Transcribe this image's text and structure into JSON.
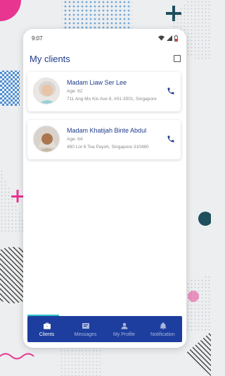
{
  "status_bar": {
    "time": "9:07"
  },
  "header": {
    "title": "My clients"
  },
  "clients": [
    {
      "name": "Madam Liaw Ser Lee",
      "age": "Age: 62",
      "address": "711 Ang Mo Kio Ave 8, #01-3501, Singapore"
    },
    {
      "name": "Madam Khatijah Binte Abdul",
      "age": "Age: 64",
      "address": "480 Lor 6 Toa Payoh, Singapore 310480"
    }
  ],
  "nav": {
    "items": [
      {
        "label": "Clients",
        "icon": "briefcase-icon"
      },
      {
        "label": "Messages",
        "icon": "message-icon"
      },
      {
        "label": "My Profile",
        "icon": "person-icon"
      },
      {
        "label": "Notification",
        "icon": "bell-icon"
      }
    ],
    "active_index": 0
  },
  "colors": {
    "primary": "#1d3e9e",
    "title": "#1f3b8c",
    "accent": "#2dbfc3",
    "pink": "#e8358f"
  }
}
